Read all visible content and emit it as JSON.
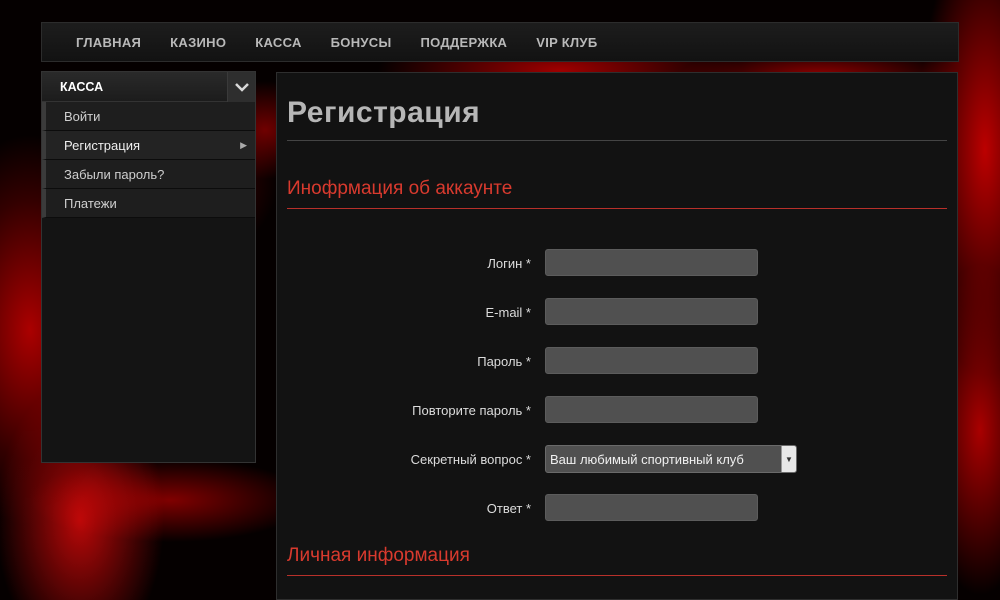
{
  "nav": {
    "items": [
      "ГЛАВНАЯ",
      "КАЗИНО",
      "КАССА",
      "БОНУСЫ",
      "ПОДДЕРЖКА",
      "VIP КЛУБ"
    ]
  },
  "sidebar": {
    "title": "КАССА",
    "items": [
      {
        "label": "Войти"
      },
      {
        "label": "Регистрация"
      },
      {
        "label": "Забыли пароль?"
      },
      {
        "label": "Платежи"
      }
    ]
  },
  "main": {
    "title": "Регистрация",
    "section_account": "Инофрмация об аккаунте",
    "section_personal": "Личная информация",
    "fields": {
      "login": {
        "label": "Логин *",
        "value": ""
      },
      "email": {
        "label": "E-mail *",
        "value": ""
      },
      "password": {
        "label": "Пароль *",
        "value": ""
      },
      "password_repeat": {
        "label": "Повторите пароль *",
        "value": ""
      },
      "secret_question": {
        "label": "Секретный вопрос *",
        "value": "Ваш любимый спортивный клуб"
      },
      "answer": {
        "label": "Ответ *",
        "value": ""
      }
    }
  },
  "colors": {
    "accent": "#d93a2e",
    "background_glow": "#c80000"
  },
  "icons": {
    "sidebar_toggle": "chevron-down-icon",
    "active_item": "triangle-right-icon",
    "select": "triangle-down-icon"
  }
}
